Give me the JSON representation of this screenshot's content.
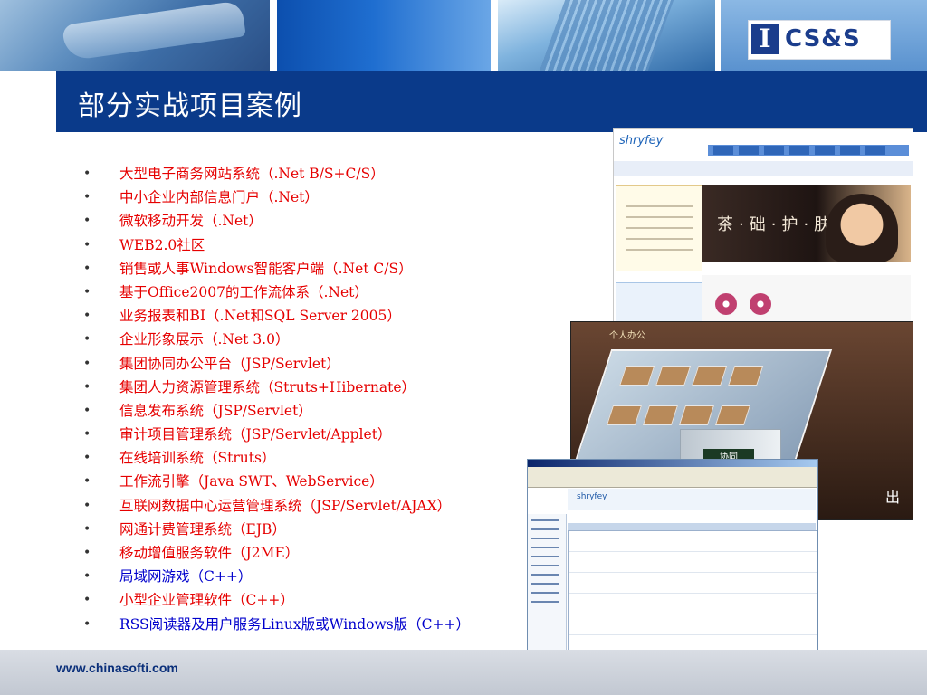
{
  "header": {
    "logo_letter": "I",
    "logo_text": "CS&S"
  },
  "slide": {
    "title": "部分实战项目案例",
    "bullets": [
      {
        "text": "大型电子商务网站系统（.Net B/S+C/S）",
        "color": "red"
      },
      {
        "text": "中小企业内部信息门户（.Net）",
        "color": "red"
      },
      {
        "text": "微软移动开发（.Net）",
        "color": "red"
      },
      {
        "text": "WEB2.0社区",
        "color": "red"
      },
      {
        "text": "销售或人事Windows智能客户端（.Net C/S）",
        "color": "red"
      },
      {
        "text": "基于Office2007的工作流体系（.Net）",
        "color": "red"
      },
      {
        "text": "业务报表和BI（.Net和SQL Server 2005）",
        "color": "red"
      },
      {
        "text": "企业形象展示（.Net 3.0）",
        "color": "red"
      },
      {
        "text": "集团协同办公平台（JSP/Servlet）",
        "color": "red"
      },
      {
        "text": "集团人力资源管理系统（Struts+Hibernate）",
        "color": "red"
      },
      {
        "text": "信息发布系统（JSP/Servlet）",
        "color": "red"
      },
      {
        "text": "审计项目管理系统（JSP/Servlet/Applet）",
        "color": "red"
      },
      {
        "text": "在线培训系统（Struts）",
        "color": "red"
      },
      {
        "text": "工作流引擎（Java SWT、WebService）",
        "color": "red"
      },
      {
        "text": "互联网数据中心运营管理系统（JSP/Servlet/AJAX）",
        "color": "red"
      },
      {
        "text": "网通计费管理系统（EJB）",
        "color": "red"
      },
      {
        "text": "移动增值服务软件（J2ME）",
        "color": "red"
      },
      {
        "text": "局域网游戏（C++）",
        "color": "blue"
      },
      {
        "text": "小型企业管理软件（C++）",
        "color": "red"
      },
      {
        "text": "RSS阅读器及用户服务Linux版或Windows版（C++）",
        "color": "blue"
      }
    ]
  },
  "screenshots": {
    "shop": {
      "brand": "shryfey",
      "ad_text": "茶·础·护·肤"
    },
    "office": {
      "tag": "个人办公",
      "sign": "协同",
      "corner_text": "出"
    }
  },
  "footer": {
    "url": "www.chinasofti.com"
  },
  "colors": {
    "title_bar": "#0a3a8a",
    "bullet_red": "#e60000",
    "bullet_blue": "#0000cc",
    "url": "#0a2f7a"
  }
}
